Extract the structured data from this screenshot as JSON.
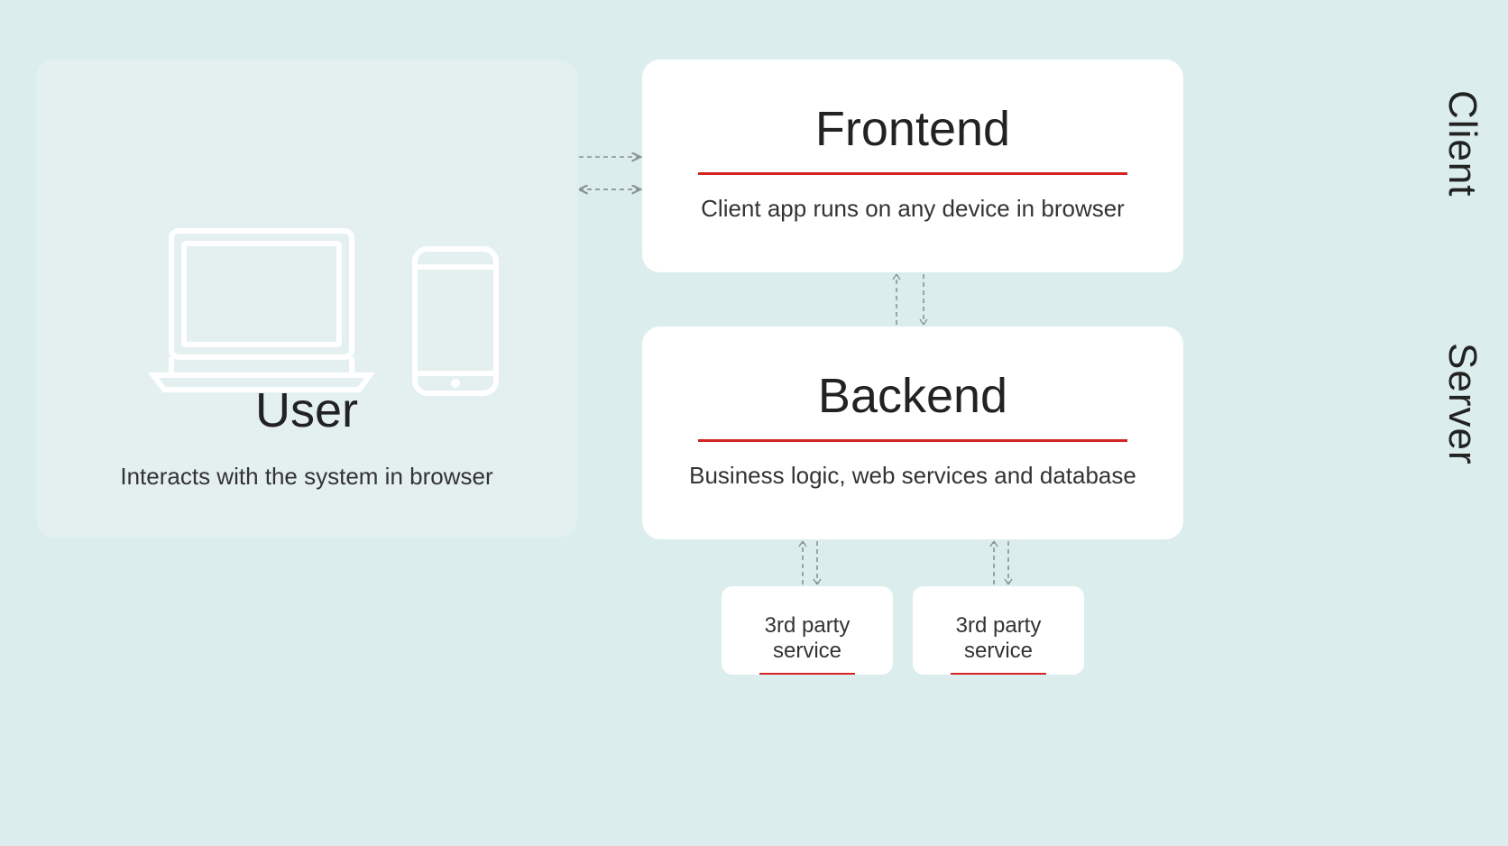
{
  "user": {
    "title": "User",
    "subtitle": "Interacts with the system in browser",
    "icons": [
      "laptop",
      "phone"
    ]
  },
  "frontend": {
    "title": "Frontend",
    "subtitle": "Client app runs on any device in browser"
  },
  "backend": {
    "title": "Backend",
    "subtitle": "Business logic, web services and database"
  },
  "third_party": [
    {
      "title": "3rd party service"
    },
    {
      "title": "3rd party service"
    }
  ],
  "side_labels": {
    "client": "Client",
    "server": "Server"
  }
}
